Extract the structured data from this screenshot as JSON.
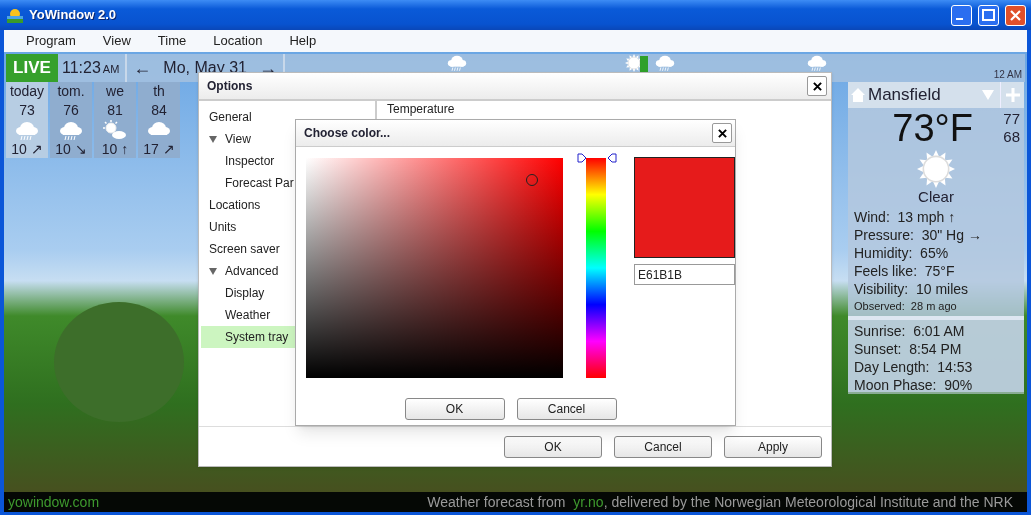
{
  "window": {
    "title": "YoWindow 2.0"
  },
  "menu": [
    "Program",
    "View",
    "Time",
    "Location",
    "Help"
  ],
  "time_bar": {
    "live": "LIVE",
    "time": "11:23",
    "ampm": "AM",
    "prev": "←",
    "date": "Mo, May 31",
    "next": "→",
    "timeline_end": "12 AM"
  },
  "days": [
    {
      "label": "today",
      "temp": "73",
      "wind": "10 ↗",
      "kind": "rain",
      "selected": true
    },
    {
      "label": "tom.",
      "temp": "76",
      "wind": "10 ↘",
      "kind": "rain",
      "selected": false
    },
    {
      "label": "we",
      "temp": "81",
      "wind": "10 ↑",
      "kind": "partly_sunny",
      "selected": false
    },
    {
      "label": "th",
      "temp": "84",
      "wind": "17 ↗",
      "kind": "cloud",
      "selected": false
    }
  ],
  "location": {
    "name": "Mansfield",
    "temp": "73°F",
    "high": "77",
    "low": "68",
    "condition": "Clear",
    "details": [
      "Wind:  13 mph ↑",
      "Pressure:  30\" Hg →",
      "Humidity:  65%",
      "Feels like:  75°F",
      "Visibility:  10 miles"
    ],
    "observed": "Observed:  28 m ago",
    "sun": [
      "Sunrise:  6:01 AM",
      "Sunset:  8:54 PM",
      "Day Length:  14:53",
      "Moon Phase:  90%"
    ]
  },
  "options": {
    "title": "Options",
    "tree": [
      {
        "label": "General",
        "selected": false
      },
      {
        "label": "View",
        "expanded": true,
        "selected": false,
        "children": [
          {
            "label": "Inspector",
            "selected": false
          },
          {
            "label": "Forecast Par",
            "selected": false
          }
        ]
      },
      {
        "label": "Locations",
        "selected": false
      },
      {
        "label": "Units",
        "selected": false
      },
      {
        "label": "Screen saver",
        "selected": false
      },
      {
        "label": "Advanced",
        "expanded": true,
        "selected": false,
        "children": [
          {
            "label": "Display",
            "selected": false
          },
          {
            "label": "Weather",
            "selected": false
          },
          {
            "label": "System tray",
            "selected": true
          }
        ]
      }
    ],
    "panel_heading": "Temperature",
    "buttons": [
      "OK",
      "Cancel",
      "Apply"
    ]
  },
  "color_dialog": {
    "title": "Choose color...",
    "hex": "E61B1B",
    "hue_slider": {
      "level": 1
    },
    "buttons": [
      "OK",
      "Cancel"
    ]
  },
  "status_bar": {
    "site": "yowindow.com",
    "credit_prefix": "Weather forecast from",
    "credit_link": "yr.no",
    "credit_suffix": ", delivered by the Norwegian Meteorological Institute and the NRK"
  }
}
